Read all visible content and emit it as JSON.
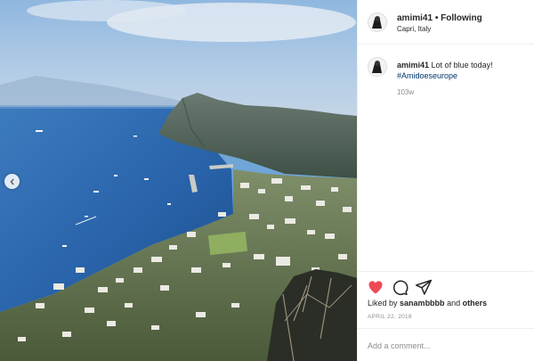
{
  "post": {
    "username": "amimi41",
    "separator": "•",
    "follow_status": "Following",
    "location": "Capri, Italy",
    "caption_username": "amimi41",
    "caption_text": "Lot of blue today!",
    "hashtag": "#Amidoeseurope",
    "age": "103w",
    "likes_prefix": "Liked by",
    "likes_user": "sanambbbb",
    "likes_conjunction": "and",
    "likes_others": "others",
    "date": "APRIL 22, 2018",
    "comment_placeholder": "Add a comment..."
  },
  "icons": {
    "prev": "chevron-left-icon",
    "like": "heart-icon",
    "comment": "comment-bubble-icon",
    "share": "paper-plane-icon"
  },
  "colors": {
    "like_red": "#ed4956",
    "hashtag_blue": "#003569",
    "muted_gray": "#8e8e8e"
  }
}
